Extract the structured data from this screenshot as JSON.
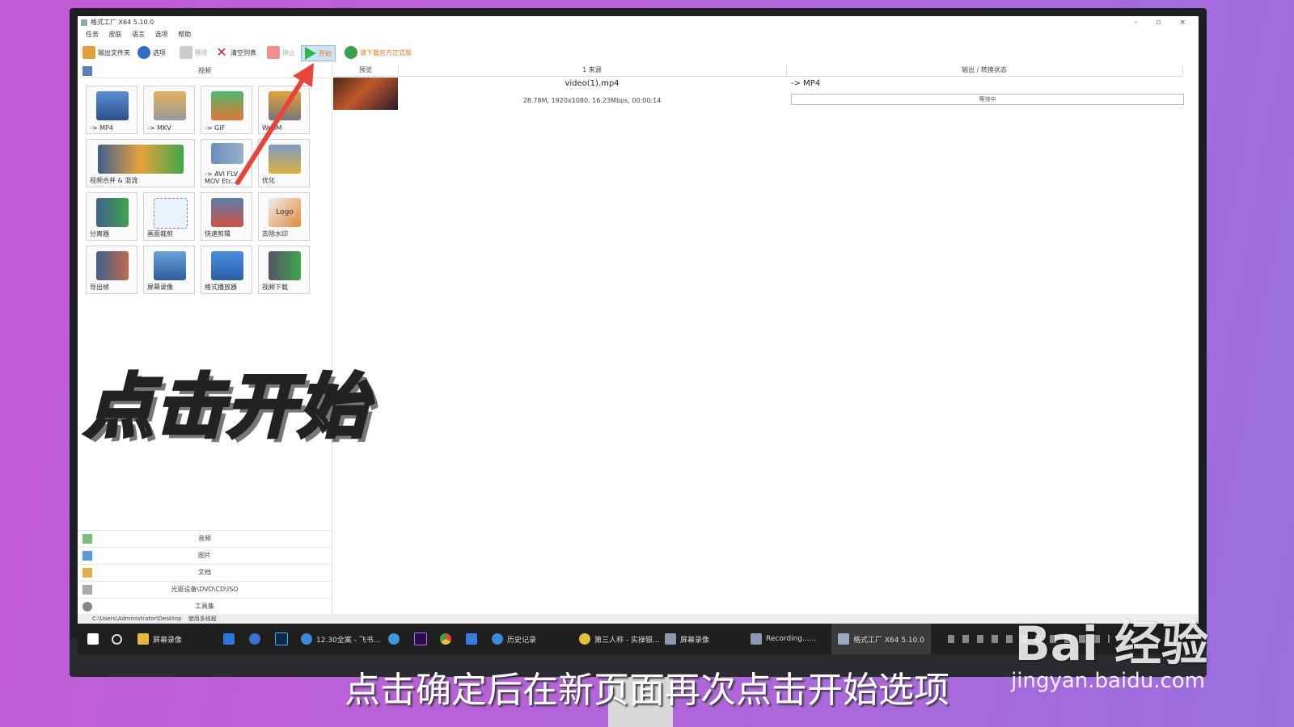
{
  "window": {
    "title": "格式工厂 X64 5.10.0",
    "controls": "– ▫ ×"
  },
  "menu": [
    "任务",
    "皮肤",
    "语言",
    "选项",
    "帮助"
  ],
  "toolbar": {
    "output_folder": "输出文件夹",
    "options": "选项",
    "remove": "移除",
    "clear_list": "清空列表",
    "stop": "停止",
    "start": "开始",
    "download_notice": "请下载官方正式版"
  },
  "sidebar": {
    "video_header": "视频",
    "tools": [
      {
        "badge": "MP4",
        "label": "-> MP4"
      },
      {
        "badge": "MKV",
        "label": "-> MKV"
      },
      {
        "badge": "GIF",
        "label": "-> GIF"
      },
      {
        "badge": "WebM",
        "label": "WebM"
      },
      {
        "badge": "",
        "label": "视频合并 & 混流"
      },
      {
        "badge": "",
        "label": "-> AVI FLV MOV Etc..."
      },
      {
        "badge": "",
        "label": "优化"
      },
      {
        "badge": "",
        "label": "分离器"
      },
      {
        "badge": "",
        "label": "画面裁剪"
      },
      {
        "badge": "",
        "label": "快速剪辑"
      },
      {
        "badge": "Logo",
        "label": "去除水印"
      },
      {
        "badge": "",
        "label": "导出帧"
      },
      {
        "badge": "",
        "label": "屏幕录像"
      },
      {
        "badge": "",
        "label": "格式播放器"
      },
      {
        "badge": "",
        "label": "视频下载"
      }
    ],
    "sections": [
      "音频",
      "图片",
      "文档",
      "光驱设备\\DVD\\CD\\ISO",
      "工具集"
    ]
  },
  "file_list": {
    "columns": [
      "预览",
      "1 来源",
      "输出 / 转换状态"
    ],
    "rows": [
      {
        "name": "video(1).mp4",
        "info": "28.78M, 1920x1080, 16.23Mbps, 00:00:14",
        "output": "-> MP4",
        "status": "等待中"
      }
    ]
  },
  "statusbar": {
    "path": "C:\\Users\\Administrator\\Desktop",
    "multithread": "使用多线程"
  },
  "taskbar": {
    "items": [
      "屏幕录像",
      "12.30全案 - 飞书...",
      "历史记录",
      "第三人称 - 实操银...",
      "屏幕录像",
      "Recording......",
      "格式工厂 X64 5.10.0"
    ]
  },
  "overlay": {
    "caption": "点击开始",
    "subtitle": "点击确定后在新页面再次点击开始选项",
    "watermark": "Bai 经验",
    "watermark_url": "jingyan.baidu.com"
  },
  "colors": {
    "arrow": "#e8443a",
    "start_icon": "#2fb84a",
    "caption_stroke": "#222222"
  }
}
